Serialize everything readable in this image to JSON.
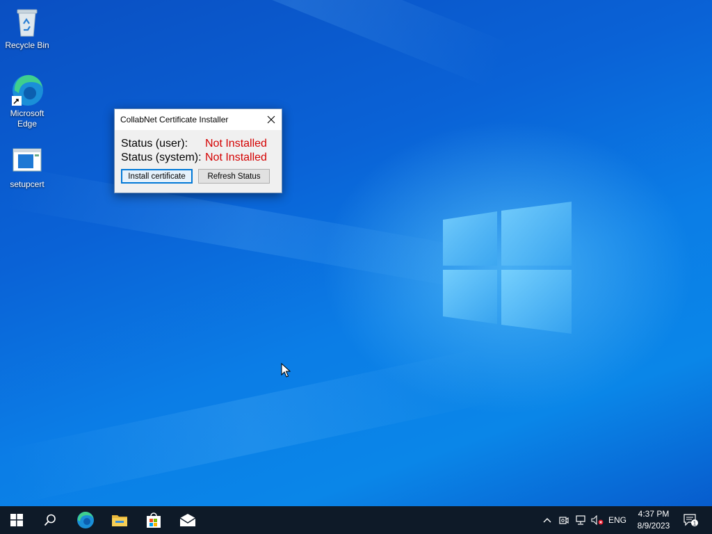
{
  "desktop": {
    "icons": [
      {
        "label": "Recycle Bin"
      },
      {
        "label": "Microsoft Edge"
      },
      {
        "label": "setupcert"
      }
    ]
  },
  "dialog": {
    "title": "CollabNet Certificate Installer",
    "status_user_label": "Status (user):",
    "status_user_value": "Not Installed",
    "status_system_label": "Status (system):",
    "status_system_value": "Not Installed",
    "install_button": "Install certificate",
    "refresh_button": "Refresh Status"
  },
  "taskbar": {
    "language": "ENG",
    "time": "4:37 PM",
    "date": "8/9/2023",
    "notification_count": "1"
  },
  "colors": {
    "status_not_installed": "#d40000",
    "taskbar": "#0e1a28",
    "accent": "#0078d7"
  }
}
